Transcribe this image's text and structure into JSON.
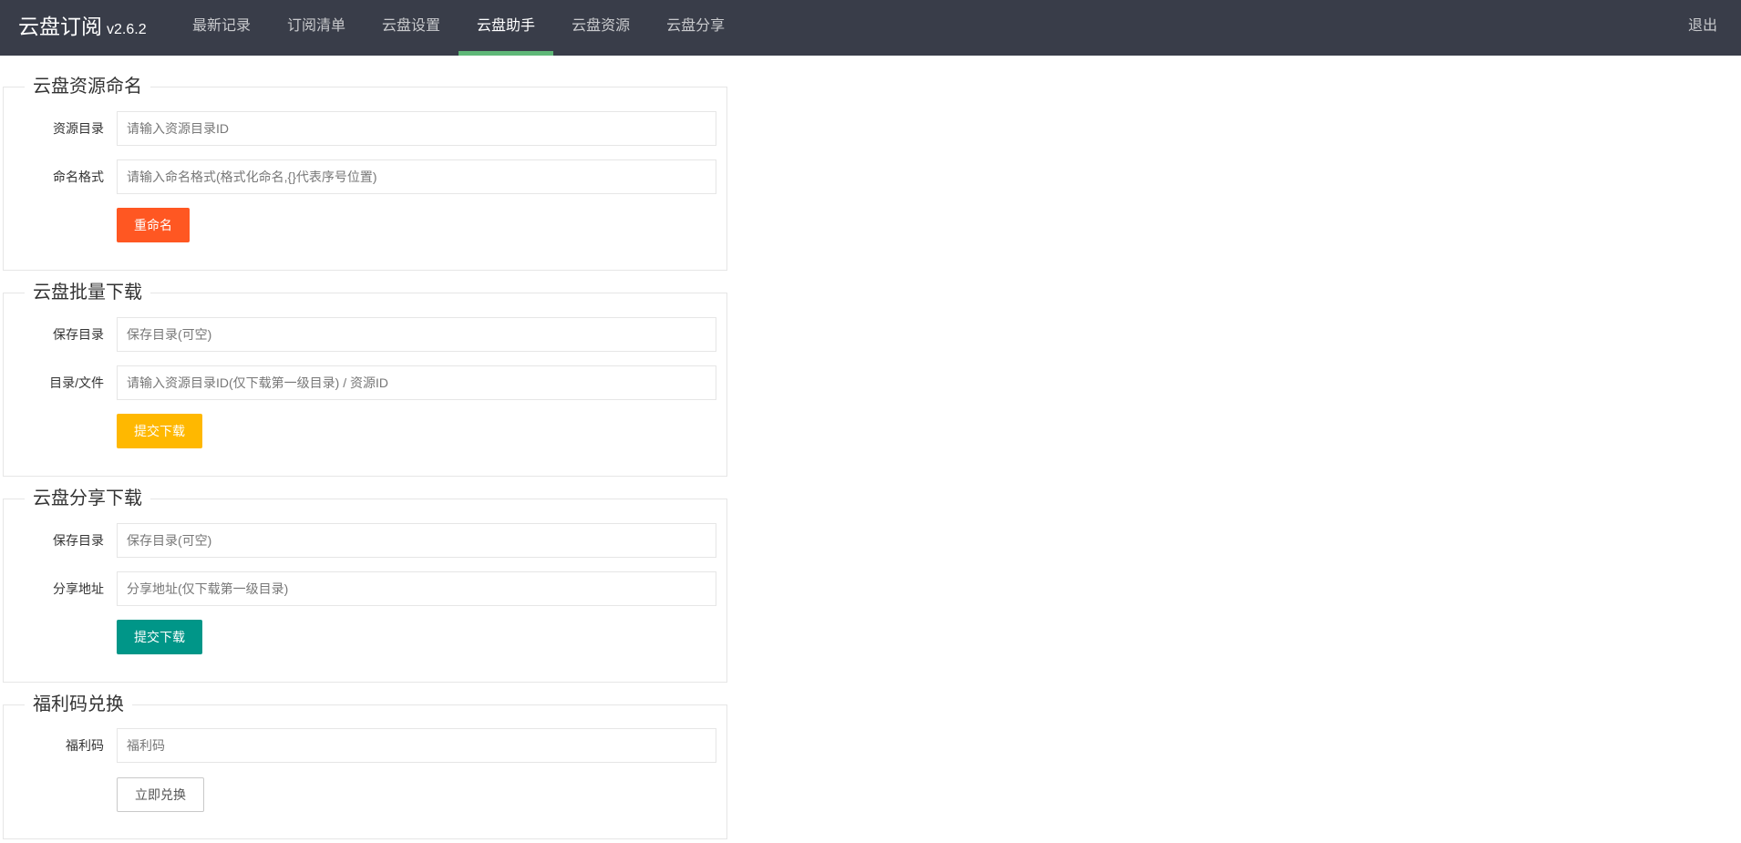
{
  "app": {
    "name": "云盘订阅",
    "version": "v2.6.2"
  },
  "nav": {
    "items": [
      {
        "label": "最新记录"
      },
      {
        "label": "订阅清单"
      },
      {
        "label": "云盘设置"
      },
      {
        "label": "云盘助手",
        "active": true
      },
      {
        "label": "云盘资源"
      },
      {
        "label": "云盘分享"
      }
    ],
    "logout": "退出",
    "accent_color": "#5fb878"
  },
  "rename": {
    "title": "云盘资源命名",
    "dir_label": "资源目录",
    "dir_placeholder": "请输入资源目录ID",
    "format_label": "命名格式",
    "format_placeholder": "请输入命名格式(格式化命名,{}代表序号位置)",
    "button": "重命名",
    "button_color": "#ff5722"
  },
  "batch_download": {
    "title": "云盘批量下载",
    "save_label": "保存目录",
    "save_placeholder": "保存目录(可空)",
    "target_label": "目录/文件",
    "target_placeholder": "请输入资源目录ID(仅下载第一级目录) / 资源ID",
    "button": "提交下载",
    "button_color": "#ffb800"
  },
  "share_download": {
    "title": "云盘分享下载",
    "save_label": "保存目录",
    "save_placeholder": "保存目录(可空)",
    "url_label": "分享地址",
    "url_placeholder": "分享地址(仅下载第一级目录)",
    "button": "提交下载",
    "button_color": "#009688"
  },
  "redeem": {
    "title": "福利码兑换",
    "code_label": "福利码",
    "code_placeholder": "福利码",
    "button": "立即兑换"
  }
}
